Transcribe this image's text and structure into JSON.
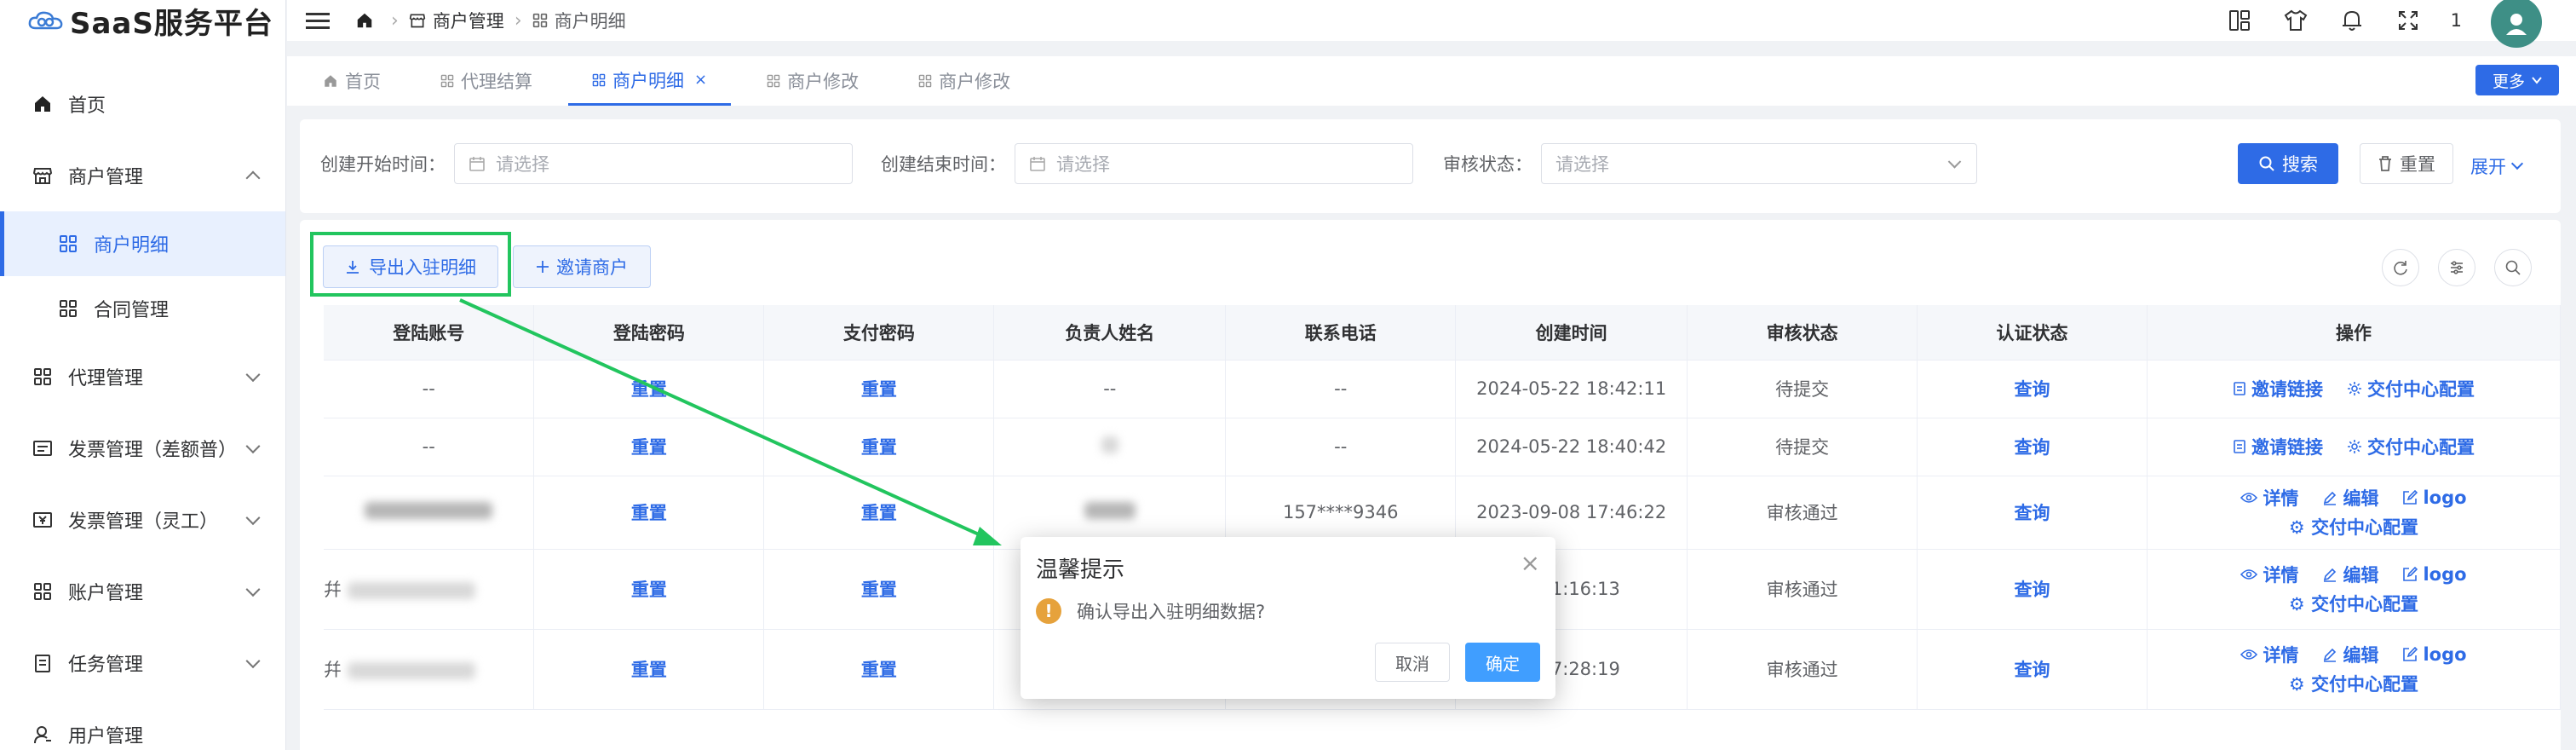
{
  "app": {
    "title": "SaaS服务平台"
  },
  "sidebar": {
    "items": [
      {
        "label": "首页"
      },
      {
        "label": "商户管理"
      },
      {
        "label": "商户明细"
      },
      {
        "label": "合同管理"
      },
      {
        "label": "代理管理"
      },
      {
        "label": "发票管理（差额普）"
      },
      {
        "label": "发票管理（灵工）"
      },
      {
        "label": "账户管理"
      },
      {
        "label": "任务管理"
      },
      {
        "label": "用户管理"
      }
    ]
  },
  "header": {
    "breadcrumb": [
      "商户管理",
      "商户明细"
    ],
    "badge_count": "1"
  },
  "tabs": [
    {
      "label": "首页"
    },
    {
      "label": "代理结算"
    },
    {
      "label": "商户明细",
      "close": "×"
    },
    {
      "label": "商户修改"
    },
    {
      "label": "商户修改"
    }
  ],
  "more_label": "更多",
  "filters": {
    "start_label": "创建开始时间：",
    "start_placeholder": "请选择",
    "end_label": "创建结束时间：",
    "end_placeholder": "请选择",
    "status_label": "审核状态：",
    "status_placeholder": "请选择",
    "search_label": "搜索",
    "reset_label": "重置",
    "expand_label": "展开"
  },
  "toolbar": {
    "export_label": "导出入驻明细",
    "invite_label": "邀请商户"
  },
  "table": {
    "columns": [
      "登陆账号",
      "登陆密码",
      "支付密码",
      "负责人姓名",
      "联系电话",
      "创建时间",
      "审核状态",
      "认证状态",
      "操作"
    ],
    "rows": [
      {
        "account": "--",
        "pwd": "重置",
        "paypwd": "重置",
        "name": "--",
        "phone": "--",
        "created": "2024-05-22 18:42:11",
        "status": "待提交",
        "auth": "查询"
      },
      {
        "account": "--",
        "pwd": "重置",
        "paypwd": "重置",
        "name": "",
        "phone": "--",
        "created": "2024-05-22 18:40:42",
        "status": "待提交",
        "auth": "查询"
      },
      {
        "account": "",
        "pwd": "重置",
        "paypwd": "重置",
        "name": "",
        "phone": "157****9346",
        "created": "2023-09-08 17:46:22",
        "status": "审核通过",
        "auth": "查询"
      },
      {
        "account": "",
        "pwd": "重置",
        "paypwd": "重置",
        "name": "",
        "phone": "",
        "created": "3 11:16:13",
        "status": "审核通过",
        "auth": "查询"
      },
      {
        "account": "",
        "pwd": "重置",
        "paypwd": "重置",
        "name": "",
        "phone": "",
        "created": "2 17:28:19",
        "status": "审核通过",
        "auth": "查询"
      }
    ],
    "ops_a": {
      "invite_link": "邀请链接",
      "delivery_config": "交付中心配置"
    },
    "ops_b": {
      "detail": "详情",
      "edit": "编辑",
      "logo": "logo",
      "delivery_config": "交付中心配置"
    },
    "row_prefix": "幷"
  },
  "modal": {
    "title": "温馨提示",
    "message": "确认导出入驻明细数据?",
    "cancel": "取消",
    "confirm": "确定",
    "close": "×"
  },
  "colors": {
    "primary": "#2e6be6",
    "highlight": "#22c55e",
    "warning": "#e6a23c"
  }
}
